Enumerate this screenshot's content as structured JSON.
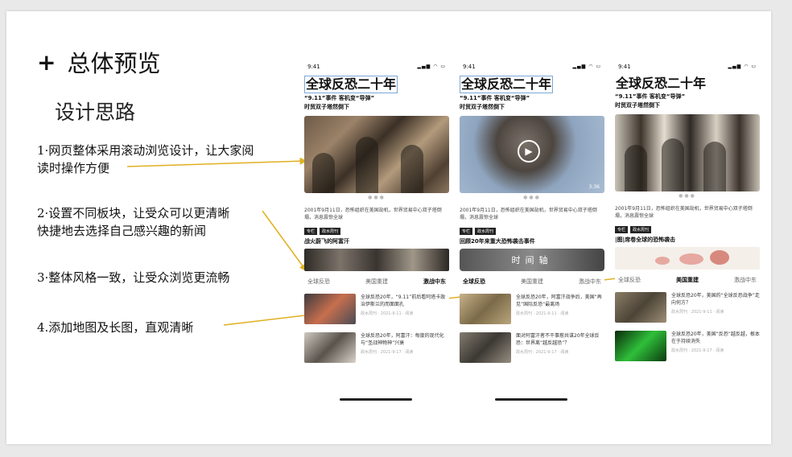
{
  "slide": {
    "plus_icon": "plus-icon",
    "title": "总体预览",
    "subtitle": "设计思路",
    "points": [
      "1·网页整体采用滚动浏览设计，让大家阅",
      "读时操作方便",
      "2·设置不同板块，让受众可以更清晰",
      "快捷地去选择自己感兴趣的新闻",
      "3·整体风格一致，让受众浏览更流畅",
      "4.添加地图及长图，直观清晰"
    ]
  },
  "phones": [
    {
      "time": "9:41",
      "title": "全球反恐二十年",
      "sub1": "“9.11”事件 客机变“导弹”",
      "sub2": "时贸双子塔然倒下",
      "para": "2001年9月11日，恐怖组织在美国劫机，世界贸易中心双子塔倒塌，消息震惊全球",
      "tag1": "专栏",
      "tag2": "政水周刊",
      "tag_line": "战火蔚飞的阿富汗",
      "tabs": [
        "全球反恐",
        "美国重建",
        "激战中东"
      ],
      "items": [
        {
          "text": "全球反恐20年，“9.11”前后看阿塔卡政治伊斯兰的而面面孔",
          "meta": "政水周刊 · 2021-9-11 · 阅读"
        },
        {
          "text": "全球反恐20年，阿富汗：每度的现代化与“圣战神物神”兴衰",
          "meta": "政水周刊 · 2021-9-17 · 阅读"
        }
      ]
    },
    {
      "time": "9:41",
      "title": "全球反恐二十年",
      "sub1": "“9.11”事件 客机变“导弹”",
      "sub2": "时贸双子塔然倒下",
      "video_time": "3:36",
      "para": "2001年9月11日，恐怖组织在美国劫机，世界贸易中心双子塔倒塌，消息震惊全球",
      "tag1": "专栏",
      "tag2": "政水周刊",
      "tag_line": "回顾20年来重大恐怖袭击事件",
      "timeline_label": "时间轴",
      "tabs": [
        "全球反恐",
        "美国重建",
        "激战中东"
      ],
      "items": [
        {
          "text": "全球反恐20年，阿富汗战争后，美国“再见”国际反恐“最离场",
          "meta": "政水周刊 · 2021-9-11 · 阅读"
        },
        {
          "text": "面对阿富汗者不干事惹共谋20年全球反恐：世界离“越反越恐”？",
          "meta": "政水周刊 · 2021-9-17 · 阅读"
        }
      ]
    },
    {
      "time": "9:41",
      "title": "全球反恐二十年",
      "sub1": "“9.11”事件 客机变“导弹”",
      "sub2": "时贸双子塔然倒下",
      "para": "2001年9月11日，恐怖组织在美国劫机，世界贸易中心双子塔倒塌，消息震惊全球",
      "tag1": "专栏",
      "tag2": "政水周刊",
      "tag_line": "|图|席卷全球的恐怖袭击",
      "tabs": [
        "全球反恐",
        "美国重建",
        "激战中东"
      ],
      "items": [
        {
          "text": "全球反恐20年，美国的“全球反恐战争”走向何方？",
          "meta": "政水周刊 · 2021-9-11 · 阅读"
        },
        {
          "text": "全球反恐20年，美国“反恐”越反越，根本在于持续消失",
          "meta": "政水周刊 · 2021-9-17 · 阅读"
        }
      ]
    }
  ]
}
